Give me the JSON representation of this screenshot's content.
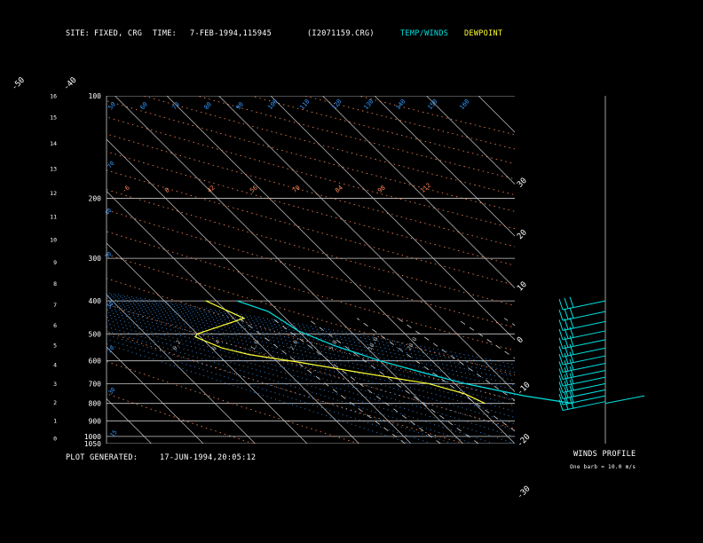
{
  "header": {
    "site_label": "SITE:",
    "site_value": "FIXED, CRG",
    "time_label": "TIME:",
    "time_value": "7-FEB-1994,115945",
    "file_id": "(I2071159.CRG)",
    "legend_temp_winds": "TEMP/WINDS",
    "legend_dewpoint": "DEWPOINT"
  },
  "footer": {
    "generated_label": "PLOT GENERATED:",
    "generated_value": "17-JUN-1994,20:05:12",
    "winds_profile_label": "WINDS PROFILE",
    "barb_note": "One barb = 10.0 m/s"
  },
  "colors": {
    "background": "#000000",
    "grid": "#c8c8c8",
    "temp_winds": "#00e0e0",
    "dewpoint": "#ffff33",
    "dry_adiabat": "#ff8855",
    "moist_adiabat": "#3399ff",
    "mixing_ratio": "#d0d0d0"
  },
  "chart_data": {
    "type": "line",
    "pressure_levels": [
      100,
      200,
      300,
      400,
      500,
      600,
      700,
      800,
      900,
      1000,
      1050
    ],
    "height_ticks_km": [
      0,
      1,
      2,
      3,
      4,
      5,
      6,
      7,
      8,
      9,
      10,
      11,
      12,
      13,
      14,
      15,
      16
    ],
    "isotherm_labels_top": [
      -110,
      -100,
      -90,
      -80,
      -70,
      -60,
      -50,
      -40
    ],
    "isotherm_labels_right": [
      -30,
      -20,
      -10,
      0,
      10,
      20,
      30
    ],
    "dry_adiabat_labels": [
      -6,
      8,
      42,
      56,
      70,
      84,
      98,
      112
    ],
    "moist_adiabat_labels": [
      50,
      60,
      70,
      80,
      90,
      100,
      110,
      120,
      130,
      140,
      150,
      160
    ],
    "moist_adiabat_labels_left": [
      20,
      30,
      40
    ],
    "mixing_ratio_labels": [
      0.2,
      0.4,
      1.0,
      2.0,
      5.0,
      10.0,
      20.0
    ],
    "series": [
      {
        "name": "TEMP/WINDS",
        "points": [
          {
            "p": 400,
            "t": -46
          },
          {
            "p": 430,
            "t": -42
          },
          {
            "p": 490,
            "t": -40
          },
          {
            "p": 540,
            "t": -36
          },
          {
            "p": 600,
            "t": -30
          },
          {
            "p": 650,
            "t": -24
          },
          {
            "p": 700,
            "t": -18
          },
          {
            "p": 760,
            "t": -9
          },
          {
            "p": 790,
            "t": -3
          },
          {
            "p": 800,
            "t": -1
          }
        ]
      },
      {
        "name": "DEWPOINT",
        "points": [
          {
            "p": 400,
            "t": -52
          },
          {
            "p": 450,
            "t": -48
          },
          {
            "p": 500,
            "t": -60
          },
          {
            "p": 510,
            "t": -61
          },
          {
            "p": 550,
            "t": -58
          },
          {
            "p": 575,
            "t": -54
          },
          {
            "p": 605,
            "t": -46
          },
          {
            "p": 650,
            "t": -36
          },
          {
            "p": 700,
            "t": -25
          },
          {
            "p": 750,
            "t": -20
          },
          {
            "p": 800,
            "t": -18
          }
        ]
      }
    ],
    "wind_levels_hpa": [
      400,
      430,
      460,
      490,
      520,
      550,
      580,
      610,
      640,
      670,
      700,
      730,
      760,
      790
    ]
  }
}
